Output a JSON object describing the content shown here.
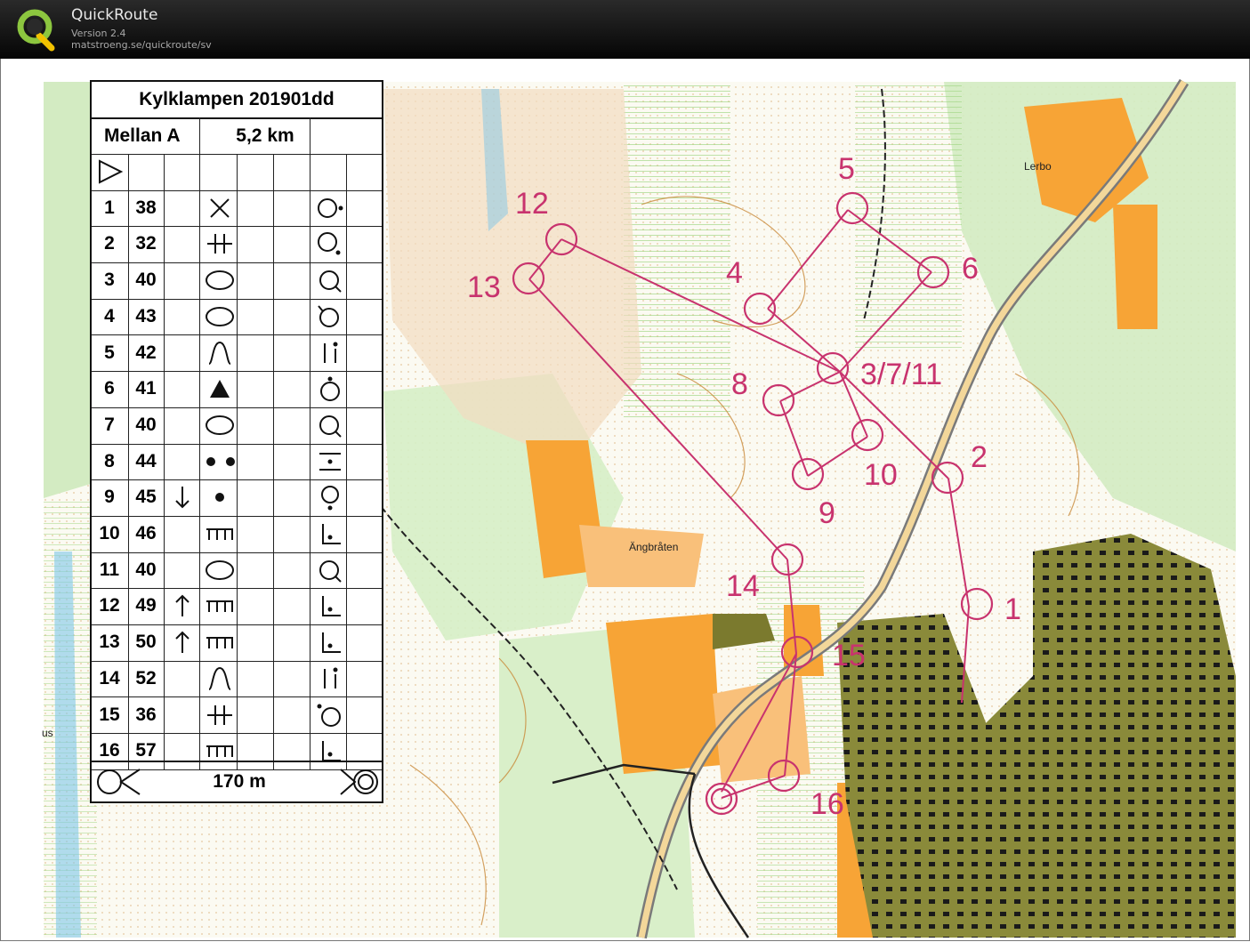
{
  "app": {
    "name": "QuickRoute",
    "version": "Version 2.4",
    "url": "matstroeng.se/quickroute/sv"
  },
  "colors": {
    "course_purple": "#c8336e",
    "field_orange": "#f7a436",
    "urban_olive": "#7b7a2e",
    "forest_white": "#fbfaf2",
    "vegetation_green": "#c7e5b5",
    "contour_brown": "#c98a3a",
    "water_blue": "#7fc6e8"
  },
  "map_labels": {
    "lerbo": "Lerbo",
    "angbraten": "Ängbråten",
    "us": "us"
  },
  "control_labels": [
    "1",
    "2",
    "3/7/11",
    "4",
    "5",
    "6",
    "8",
    "9",
    "10",
    "12",
    "13",
    "14",
    "15",
    "16"
  ],
  "description_sheet": {
    "event": "Kylklampen 201901dd",
    "class": "Mellan A",
    "length": "5,2 km",
    "start_symbol": "triangle",
    "finish_distance": "170 m",
    "rows": [
      {
        "n": "1",
        "code": "38",
        "dir": "",
        "feature": "cross",
        "position": "circle-dot-right"
      },
      {
        "n": "2",
        "code": "32",
        "dir": "",
        "feature": "fence-crossing",
        "position": "circle-dot-bottom-right"
      },
      {
        "n": "3",
        "code": "40",
        "dir": "",
        "feature": "ellipse",
        "position": "circle-tail"
      },
      {
        "n": "4",
        "code": "43",
        "dir": "",
        "feature": "ellipse",
        "position": "circle-tail-top"
      },
      {
        "n": "5",
        "code": "42",
        "dir": "",
        "feature": "gully",
        "position": "bar-dot"
      },
      {
        "n": "6",
        "code": "41",
        "dir": "",
        "feature": "triangle-filled",
        "position": "circle-dot-top"
      },
      {
        "n": "7",
        "code": "40",
        "dir": "",
        "feature": "ellipse",
        "position": "circle-tail"
      },
      {
        "n": "8",
        "code": "44",
        "dir": "",
        "feature": "two-dots",
        "position": "dash-dot"
      },
      {
        "n": "9",
        "code": "45",
        "dir": "arrow-down",
        "feature": "dot",
        "position": "circle-dot-below"
      },
      {
        "n": "10",
        "code": "46",
        "dir": "",
        "feature": "comb",
        "position": "corner-dot"
      },
      {
        "n": "11",
        "code": "40",
        "dir": "",
        "feature": "ellipse",
        "position": "circle-tail"
      },
      {
        "n": "12",
        "code": "49",
        "dir": "arrow-up",
        "feature": "comb",
        "position": "corner-dot"
      },
      {
        "n": "13",
        "code": "50",
        "dir": "arrow-up",
        "feature": "comb",
        "position": "corner-dot"
      },
      {
        "n": "14",
        "code": "52",
        "dir": "",
        "feature": "gully",
        "position": "bar-dot"
      },
      {
        "n": "15",
        "code": "36",
        "dir": "",
        "feature": "fence-crossing",
        "position": "circle-dot-top-left"
      },
      {
        "n": "16",
        "code": "57",
        "dir": "",
        "feature": "comb",
        "position": "corner-dot"
      }
    ]
  }
}
